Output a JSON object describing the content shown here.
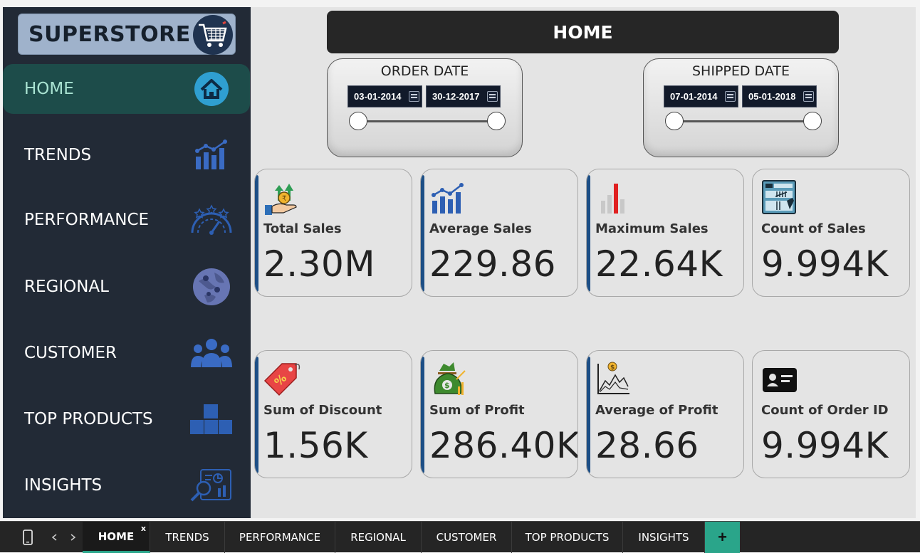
{
  "brand": {
    "title": "SUPERSTORE",
    "icon": "shopping-cart-icon"
  },
  "nav": [
    {
      "label": "HOME",
      "icon": "house-icon",
      "active": true
    },
    {
      "label": "TRENDS",
      "icon": "bar-trend-icon"
    },
    {
      "label": "PERFORMANCE",
      "icon": "speedometer-stars-icon"
    },
    {
      "label": "REGIONAL",
      "icon": "globe-pins-icon"
    },
    {
      "label": "CUSTOMER",
      "icon": "people-group-icon"
    },
    {
      "label": "TOP PRODUCTS",
      "icon": "boxes-icon"
    },
    {
      "label": "INSIGHTS",
      "icon": "report-magnifier-icon"
    }
  ],
  "header": {
    "title": "HOME"
  },
  "slicers": {
    "order_date": {
      "title": "ORDER DATE",
      "start": "03-01-2014",
      "end": "30-12-2017"
    },
    "shipped_date": {
      "title": "SHIPPED DATE",
      "start": "07-01-2014",
      "end": "05-01-2018"
    }
  },
  "kpis": [
    {
      "label": "Total Sales",
      "value": "2.30M",
      "icon": "money-hand-icon"
    },
    {
      "label": "Average Sales",
      "value": "229.86",
      "icon": "bar-trend-icon"
    },
    {
      "label": "Maximum Sales",
      "value": "22.64K",
      "icon": "max-bar-icon"
    },
    {
      "label": "Count of Sales",
      "value": "9.994K",
      "icon": "tally-ledger-icon"
    },
    {
      "label": "Sum of Discount",
      "value": "1.56K",
      "icon": "discount-tag-icon"
    },
    {
      "label": "Sum of Profit",
      "value": "286.40K",
      "icon": "money-bag-icon"
    },
    {
      "label": "Average of Profit",
      "value": "28.66",
      "icon": "profit-chart-icon"
    },
    {
      "label": "Count of Order ID",
      "value": "9.994K",
      "icon": "id-card-icon"
    }
  ],
  "tabs": [
    "HOME",
    "TRENDS",
    "PERFORMANCE",
    "REGIONAL",
    "CUSTOMER",
    "TOP PRODUCTS",
    "INSIGHTS"
  ],
  "tabbar": {
    "close": "x",
    "add": "+",
    "mobile_icon": "mobile-layout-icon"
  },
  "colors": {
    "sidebar": "#222a36",
    "active_nav": "#1d4c4a",
    "accent": "#1d4f86",
    "tab_accent": "#2aa58a"
  }
}
